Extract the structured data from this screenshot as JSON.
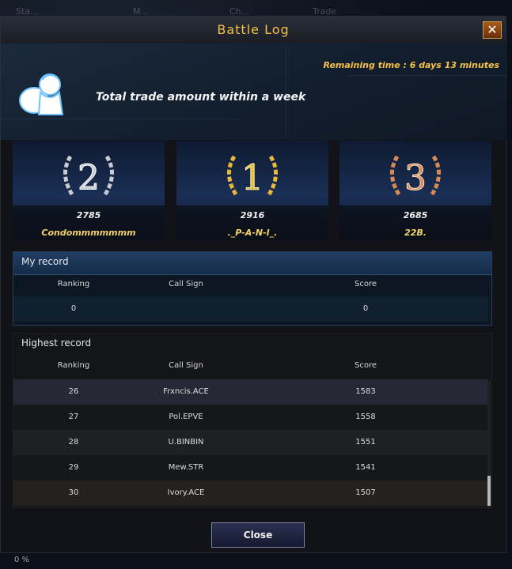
{
  "background": {
    "tabs": [
      "Sta...",
      "M...",
      "Ch...",
      "Trade"
    ]
  },
  "window": {
    "title": "Battle Log"
  },
  "hero": {
    "remaining_time": "Remaining time : 6 days 13 minutes",
    "label": "Total trade amount within a week"
  },
  "podium": [
    {
      "rank": "2",
      "score": "2785",
      "name": "Condommmmmmm",
      "medal_color": "#c9ccd2"
    },
    {
      "rank": "1",
      "score": "2916",
      "name": "._P-A-N-I_.",
      "medal_color": "#e7b93a"
    },
    {
      "rank": "3",
      "score": "2685",
      "name": "22B.",
      "medal_color": "#d88a55"
    }
  ],
  "my_record": {
    "title": "My record",
    "columns": [
      "Ranking",
      "Call Sign",
      "Score"
    ],
    "row": {
      "ranking": "0",
      "call_sign": "",
      "score": "0"
    }
  },
  "highest_record": {
    "title": "Highest record",
    "columns": [
      "Ranking",
      "Call Sign",
      "Score"
    ],
    "rows": [
      {
        "ranking": "26",
        "call_sign": "Frxncis.ACE",
        "score": "1583"
      },
      {
        "ranking": "27",
        "call_sign": "Pol.EPVE",
        "score": "1558"
      },
      {
        "ranking": "28",
        "call_sign": "U.BINBIN",
        "score": "1551"
      },
      {
        "ranking": "29",
        "call_sign": "Mew.STR",
        "score": "1541"
      },
      {
        "ranking": "30",
        "call_sign": "Ivory.ACE",
        "score": "1507"
      }
    ]
  },
  "buttons": {
    "close": "Close"
  },
  "status": {
    "progress": "0 %"
  },
  "colors": {
    "accent_gold": "#f5c246",
    "panel_blue": "#152c49"
  }
}
